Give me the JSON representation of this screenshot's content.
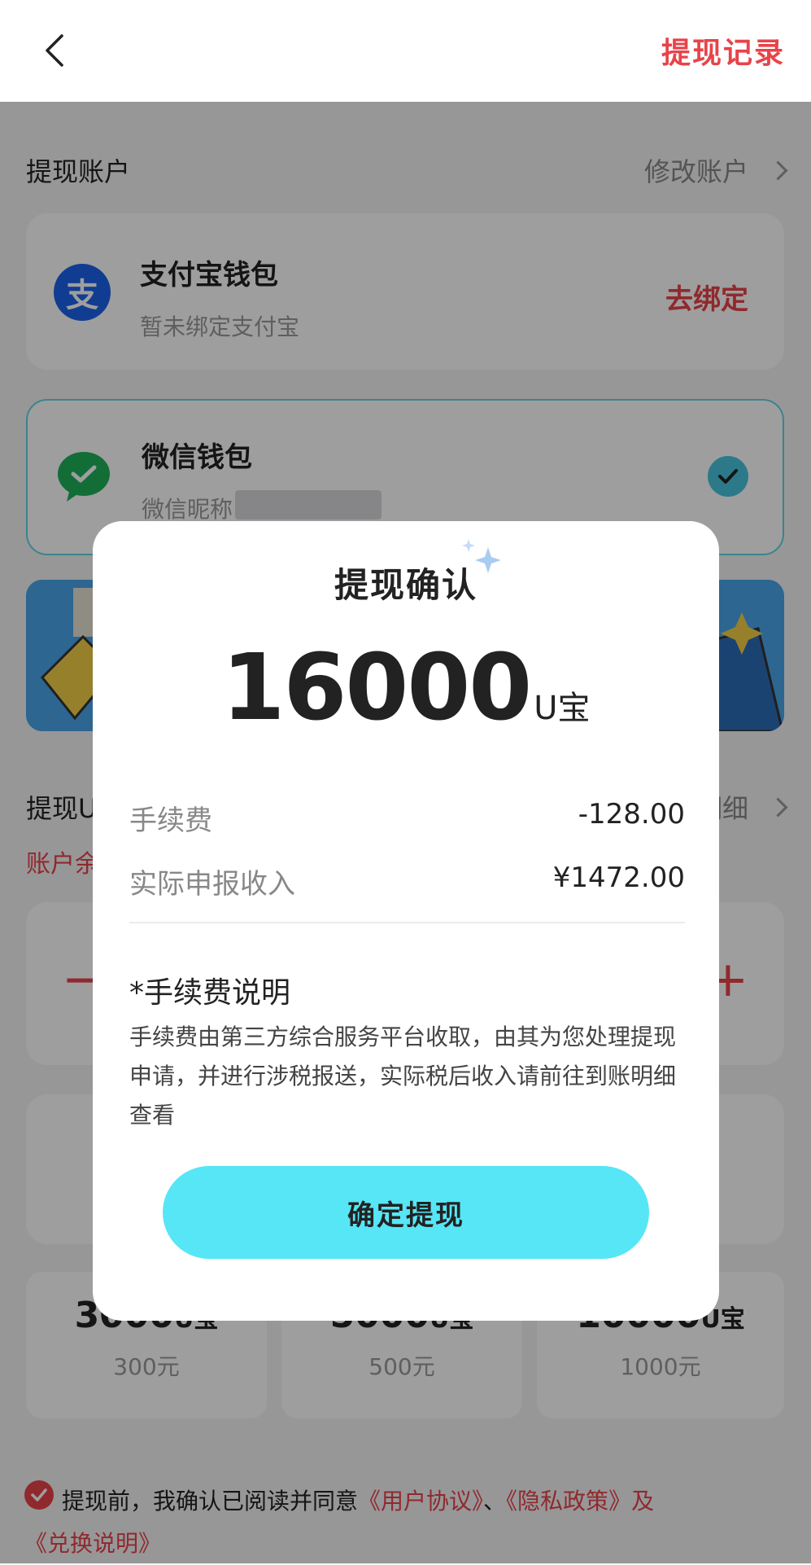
{
  "header": {
    "record_label": "提现记录"
  },
  "account": {
    "title": "提现账户",
    "modify_label": "修改账户",
    "alipay": {
      "name": "支付宝钱包",
      "sub": "暂未绑定支付宝",
      "action": "去绑定",
      "icon": "alipay-icon",
      "icon_char": "支"
    },
    "wechat": {
      "name": "微信钱包",
      "sub": "微信昵称",
      "icon": "wechat-icon",
      "selected": true
    }
  },
  "withdraw": {
    "title": "提现U宝",
    "detail_label": "明细",
    "balance_label": "账户余额",
    "minus": "−",
    "plus": "+",
    "options": [
      {
        "amount": "3000",
        "unit": "U宝",
        "money": "300元"
      },
      {
        "amount": "5000",
        "unit": "U宝",
        "money": "500元"
      },
      {
        "amount": "10000",
        "unit": "U宝",
        "money": "1000元"
      }
    ]
  },
  "agreement": {
    "prefix": "提现前，我确认已阅读并同意",
    "user_agreement": "《用户协议》",
    "sep": "、",
    "privacy": "《隐私政策》",
    "and": "及",
    "exchange": "《兑换说明》"
  },
  "modal": {
    "title": "提现确认",
    "amount": "16000",
    "unit": "U宝",
    "fee_label": "手续费",
    "fee_value": "-128.00",
    "income_label": "实际申报收入",
    "income_value": "¥1472.00",
    "note_title": "*手续费说明",
    "note_body": "手续费由第三方综合服务平台收取，由其为您处理提现申请，并进行涉税报送，实际税后收入请前往到账明细查看",
    "confirm_label": "确定提现"
  },
  "colors": {
    "accent": "#e8434a",
    "primary_button": "#56e6f6",
    "check": "#47c6dd"
  }
}
